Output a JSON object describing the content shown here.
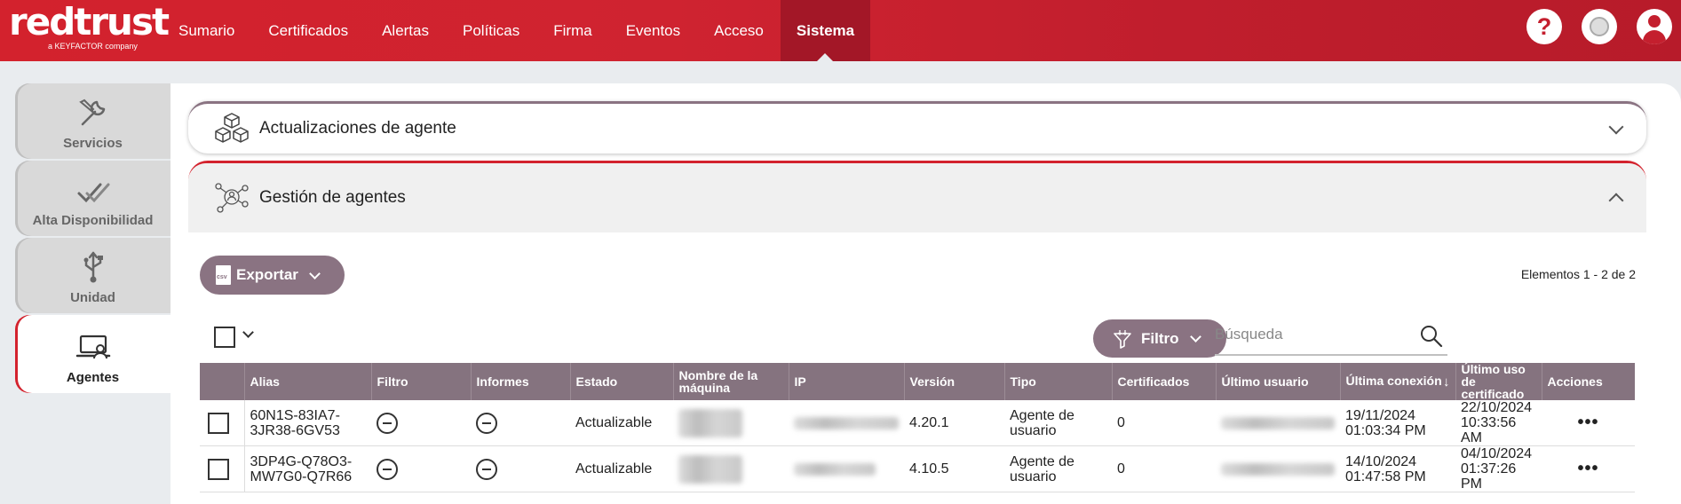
{
  "logo": {
    "name": "redtrust",
    "tagline": "a KEYFACTOR company"
  },
  "nav": {
    "items": [
      "Sumario",
      "Certificados",
      "Alertas",
      "Políticas",
      "Firma",
      "Eventos",
      "Acceso",
      "Sistema"
    ],
    "active": "Sistema"
  },
  "top_icons": [
    "help-icon",
    "status-icon",
    "user-icon"
  ],
  "sidebar": {
    "items": [
      {
        "label": "Servicios",
        "icon": "wrench-icon"
      },
      {
        "label": "Alta Disponibilidad",
        "icon": "double-check-icon"
      },
      {
        "label": "Unidad",
        "icon": "usb-icon"
      },
      {
        "label": "Agentes",
        "icon": "laptop-user-icon",
        "active": true
      }
    ]
  },
  "accordion": {
    "updates_title": "Actualizaciones de agente",
    "management_title": "Gestión de agentes"
  },
  "toolbar": {
    "export_label": "Exportar",
    "count_text": "Elementos 1 - 2 de 2",
    "filter_label": "Filtro",
    "search_placeholder": "Búsqueda"
  },
  "table": {
    "headers": [
      "Alias",
      "Filtro",
      "Informes",
      "Estado",
      "Nombre de la máquina",
      "IP",
      "Versión",
      "Tipo",
      "Certificados",
      "Último usuario",
      "Última conexión",
      "Último uso de certificado",
      "Acciones"
    ],
    "sorted_column": "Última conexión",
    "sort_direction": "descending",
    "rows": [
      {
        "alias": "60N1S-83IA7-3JR38-6GV53",
        "estado": "Actualizable",
        "version": "4.20.1",
        "tipo": "Agente de usuario",
        "certificados": "0",
        "ultima_conexion": "19/11/2024 01:03:34 PM",
        "ultimo_uso": "22/10/2024 10:33:56 AM"
      },
      {
        "alias": "3DP4G-Q78O3-MW7G0-Q7R66",
        "estado": "Actualizable",
        "version": "4.10.5",
        "tipo": "Agente de usuario",
        "certificados": "0",
        "ultima_conexion": "14/10/2024 01:47:58 PM",
        "ultimo_uso": "04/10/2024 01:37:26 PM"
      }
    ]
  },
  "colors": {
    "brand_red": "#d3222d",
    "accent_mauve": "#85737f",
    "header_bg": "#8a7382"
  }
}
